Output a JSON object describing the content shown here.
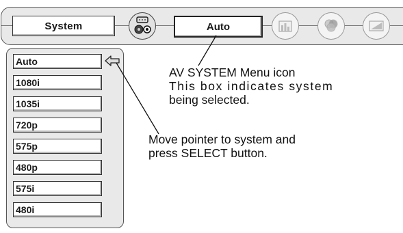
{
  "top_menu": {
    "system_label": "System",
    "selected_mode": "Auto",
    "icons": [
      "av-system-icon",
      "image-icon",
      "color-icon",
      "screen-icon"
    ]
  },
  "system_list": {
    "items": [
      "Auto",
      "1080i",
      "1035i",
      "720p",
      "575p",
      "480p",
      "575i",
      "480i"
    ],
    "selected": "Auto"
  },
  "annotations": {
    "av_icon_line1": "AV SYSTEM Menu icon",
    "av_icon_line2": "This box indicates system",
    "av_icon_line3": "being selected.",
    "pointer_line1": "Move pointer to system and",
    "pointer_line2": "press SELECT button."
  }
}
